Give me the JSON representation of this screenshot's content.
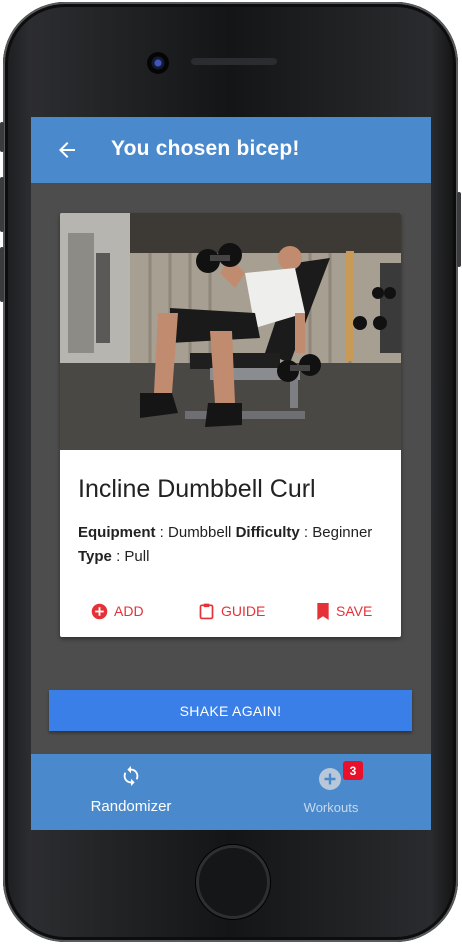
{
  "appbar": {
    "title": "You chosen bicep!"
  },
  "exercise": {
    "name": "Incline Dumbbell Curl",
    "equipment_label": "Equipment",
    "equipment_value": "Dumbbell",
    "difficulty_label": "Difficulty",
    "difficulty_value": "Beginner",
    "type_label": "Type",
    "type_value": "Pull",
    "separator": " : "
  },
  "actions": {
    "add": "ADD",
    "guide": "GUIDE",
    "save": "SAVE"
  },
  "shake_button": "SHAKE AGAIN!",
  "bottom_nav": {
    "randomizer": "Randomizer",
    "workouts": "Workouts",
    "workouts_badge": "3"
  },
  "colors": {
    "primary": "#4a89cc",
    "accent_red": "#e53238",
    "button_blue": "#3a7fe8",
    "background": "#4d4d4d"
  },
  "icons": [
    "arrow-back-icon",
    "add-circle-icon",
    "clipboard-icon",
    "bookmark-icon",
    "refresh-icon",
    "add-circle-outline-icon"
  ]
}
